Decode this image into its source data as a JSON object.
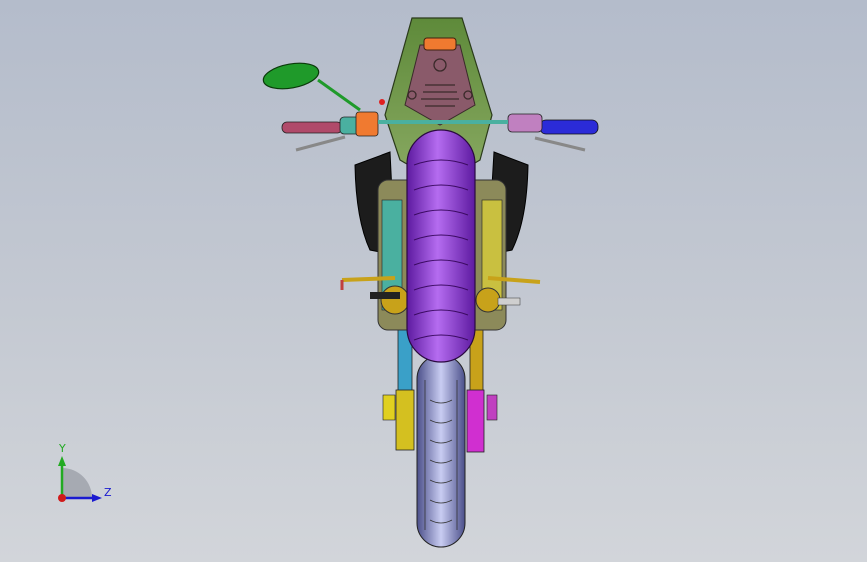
{
  "viewport": {
    "background_top": "#b4bccb",
    "background_bottom": "#d2d5da"
  },
  "model": {
    "description_icon": "motorcycle-rear-view-model",
    "colors": {
      "rear_tire": "#8a2bd6",
      "front_tire": "#7f86c8",
      "tail_fairing": "#6f8f3a",
      "mirror": "#1f9a2a",
      "fork_gold": "#c8a21a",
      "fork_blue": "#3a63c8",
      "fork_magenta": "#d02fd0",
      "handle_left": "#b04a6a",
      "handle_right": "#2b2bd8",
      "plate": "#f07a30",
      "side_fairing": "#1a1a1a"
    }
  },
  "triad": {
    "y_label": "Y",
    "z_label": "Z",
    "y_color": "#22aa22",
    "z_color": "#1a1ad0",
    "x_color": "#d01a1a"
  }
}
